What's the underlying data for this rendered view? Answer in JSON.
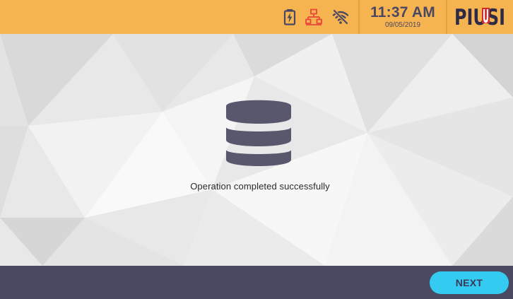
{
  "status_bar": {
    "icons": [
      "battery-charging-icon",
      "network-icon",
      "wifi-off-icon"
    ],
    "time": "11:37 AM",
    "date": "09/05/2019",
    "logo": "PIUSI",
    "colors": {
      "bar": "#f6b451",
      "network_icon": "#e8463b",
      "text": "#4a4762"
    }
  },
  "main": {
    "icon": "database-icon",
    "message": "Operation completed successfully"
  },
  "footer": {
    "next_label": "NEXT",
    "colors": {
      "bar": "#4b4962",
      "button": "#34cbf3"
    }
  }
}
